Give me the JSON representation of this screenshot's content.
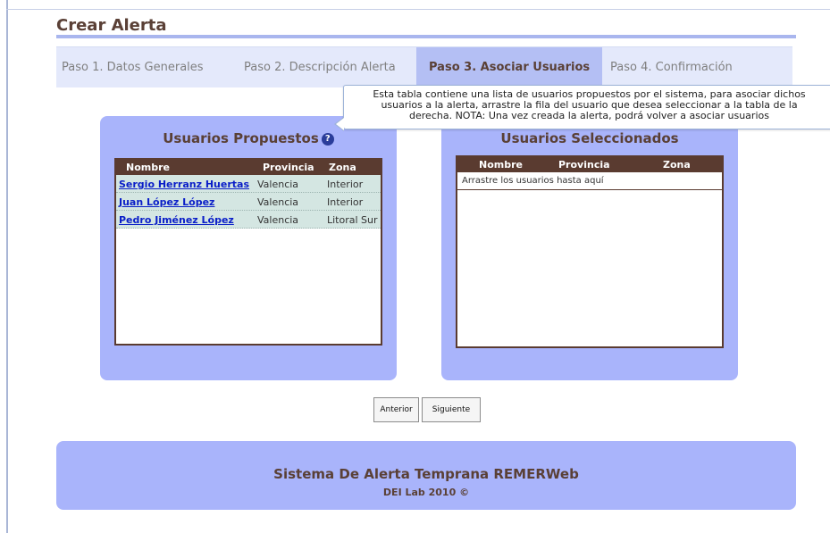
{
  "header": {
    "title": "Crear Alerta"
  },
  "steps": [
    {
      "label": "Paso 1. Datos Generales",
      "active": false
    },
    {
      "label": "Paso 2. Descripción Alerta",
      "active": false
    },
    {
      "label": "Paso 3. Asociar Usuarios",
      "active": true
    },
    {
      "label": "Paso 4. Confirmación",
      "active": false
    }
  ],
  "tooltip": {
    "lines": [
      "Esta tabla contiene una lista de usuarios propuestos por el sistema, para asociar dichos",
      "usuarios a la alerta, arrastre la fila del usuario que desea seleccionar a la tabla de la",
      "derecha. NOTA: Una vez creada la alerta, podrá volver a asociar usuarios"
    ]
  },
  "proposed": {
    "title": "Usuarios Propuestos",
    "help_icon": "question-circle-icon",
    "columns": [
      "Nombre",
      "Provincia",
      "Zona"
    ],
    "rows": [
      {
        "name": "Sergio Herranz Huertas",
        "province": "Valencia",
        "zone": "Interior"
      },
      {
        "name": "Juan López López",
        "province": "Valencia",
        "zone": "Interior"
      },
      {
        "name": "Pedro Jiménez López",
        "province": "Valencia",
        "zone": "Litoral Sur"
      }
    ]
  },
  "selected": {
    "title": "Usuarios Seleccionados",
    "columns": [
      "Nombre",
      "Provincia",
      "Zona"
    ],
    "empty_text": "Arrastre los usuarios hasta aquí"
  },
  "buttons": {
    "prev": "Anterior",
    "next": "Siguiente"
  },
  "footer": {
    "title": "Sistema De Alerta Temprana REMERWeb",
    "subtitle": "DEI Lab 2010 ©"
  },
  "colors": {
    "accent": "#a9b4fb",
    "active_step": "#b4bff4",
    "table_header": "#5a3b30",
    "row_bg": "#d4e6e2",
    "link": "#0a1ec8",
    "title_text": "#5a4036"
  }
}
